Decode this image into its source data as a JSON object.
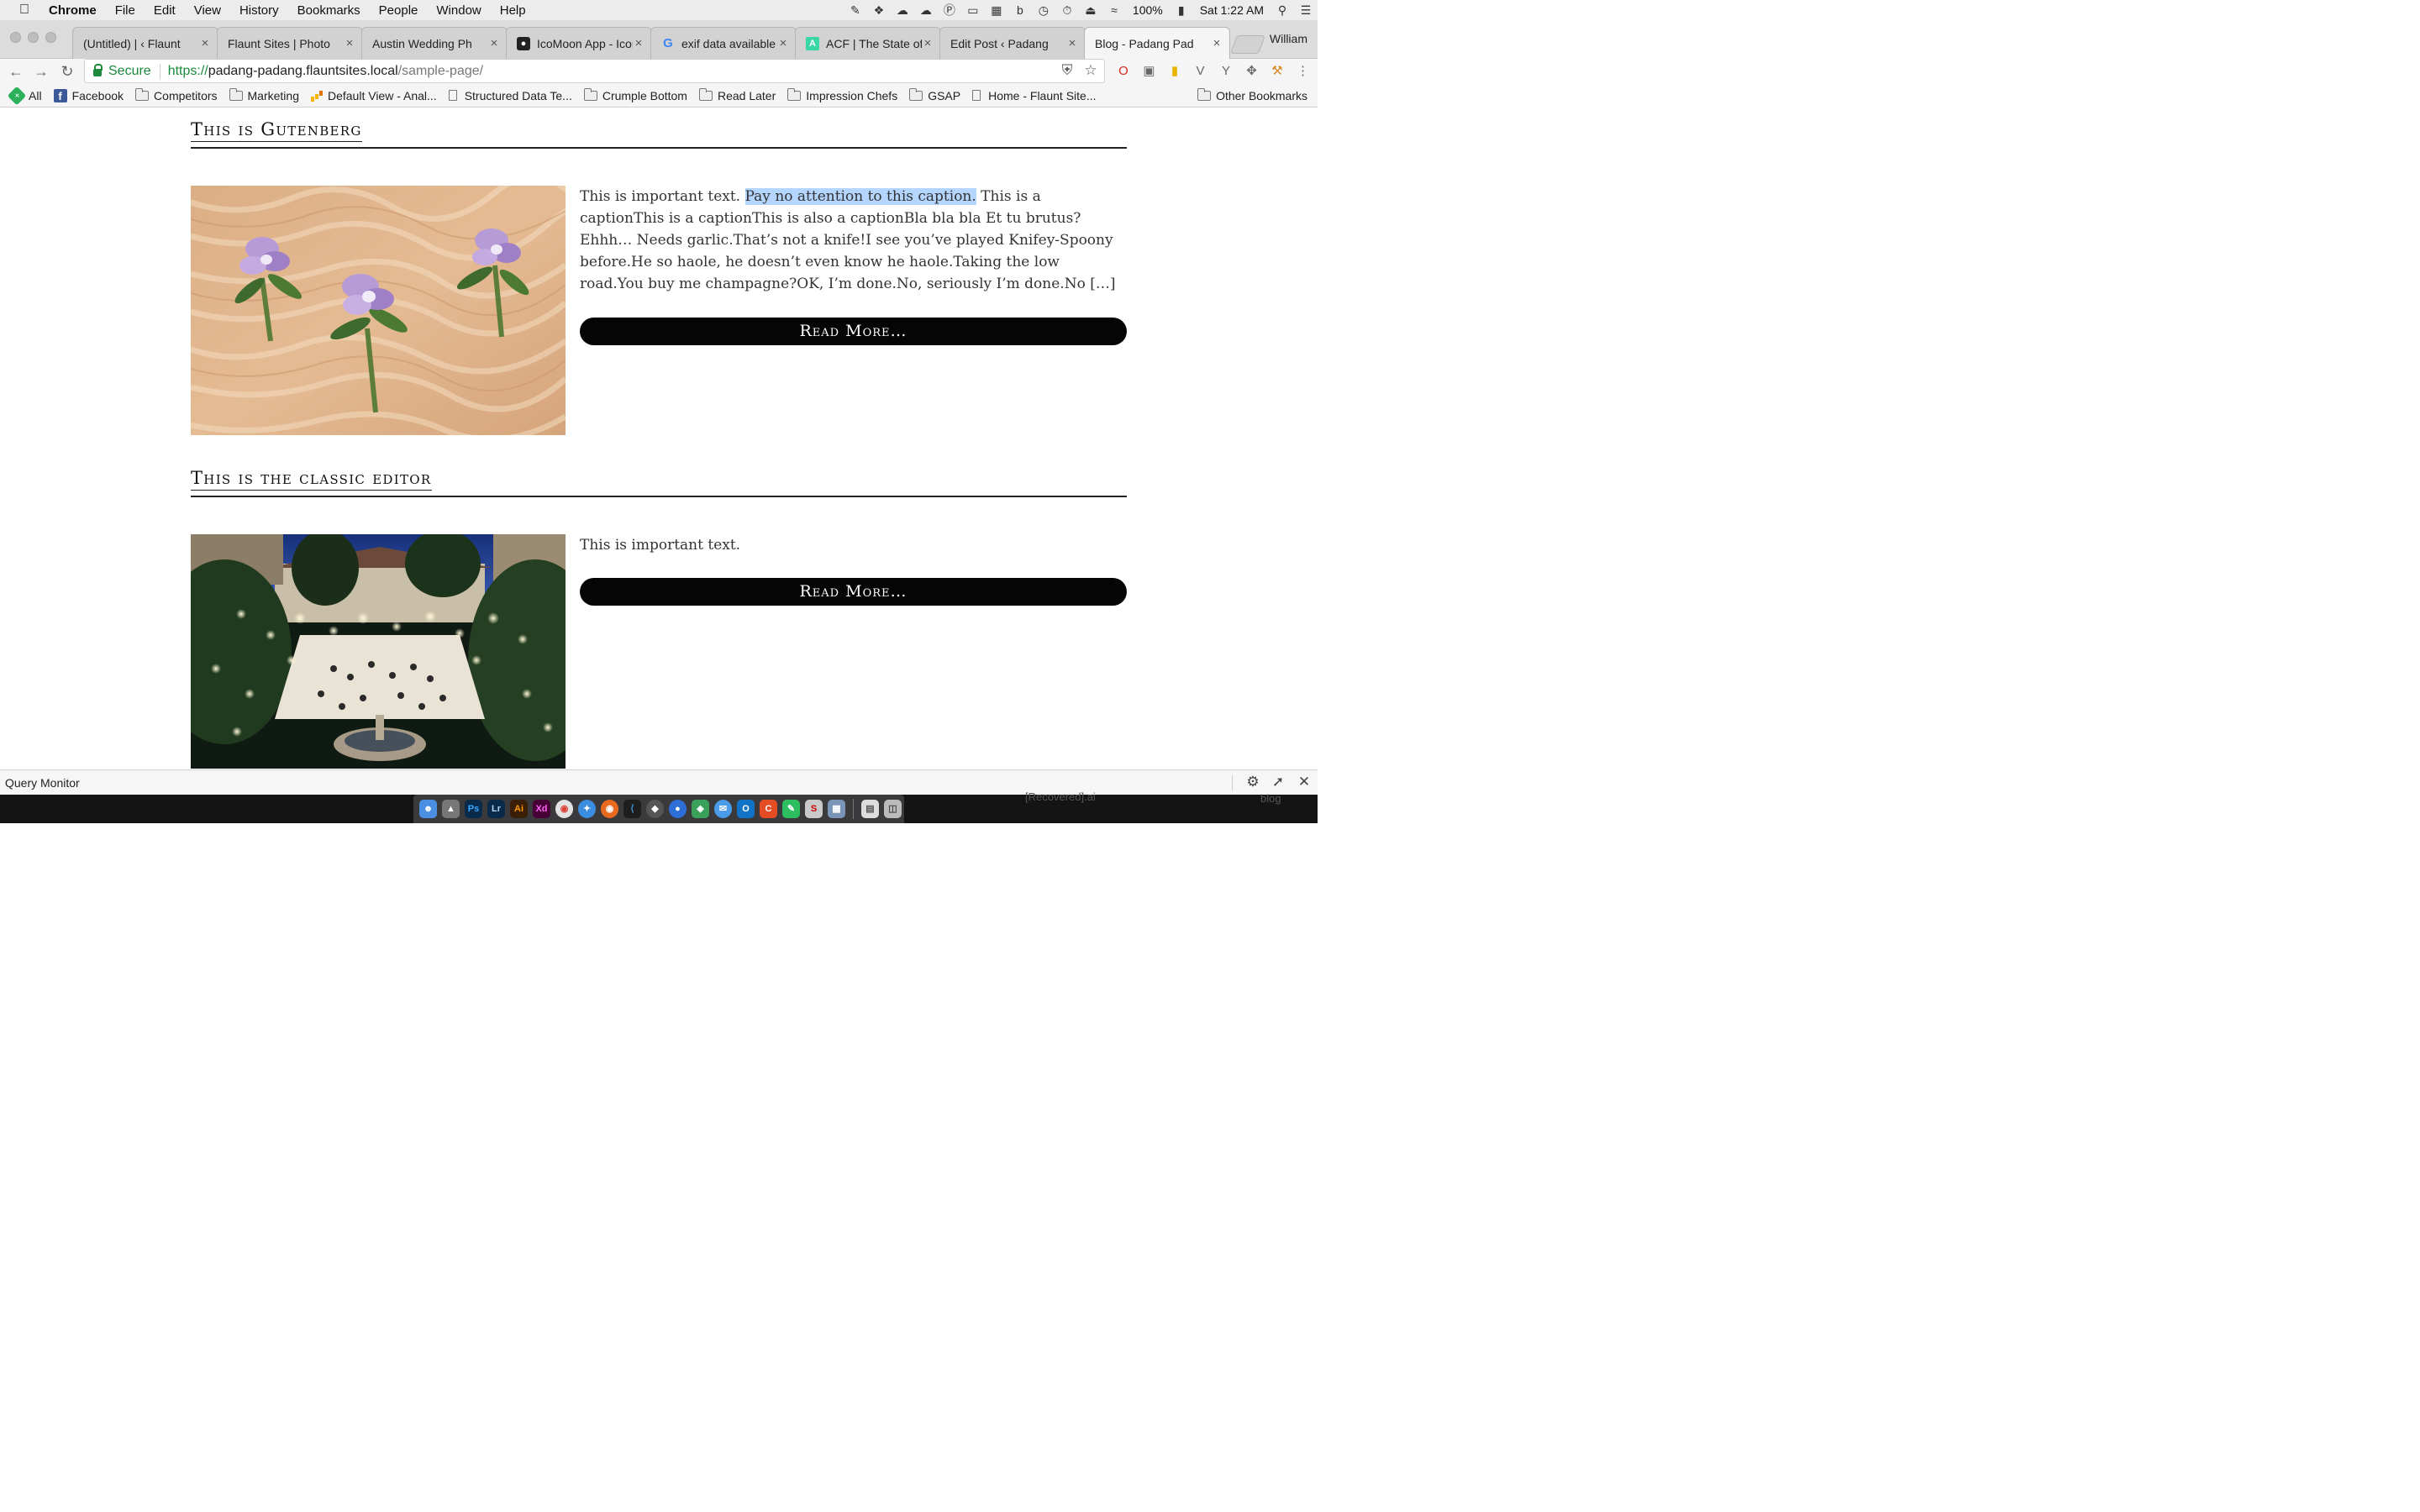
{
  "menubar": {
    "app_name": "Chrome",
    "items": [
      "File",
      "Edit",
      "View",
      "History",
      "Bookmarks",
      "People",
      "Window",
      "Help"
    ],
    "battery": "100%",
    "clock": "Sat 1:22 AM"
  },
  "tabs": [
    {
      "title": "(Untitled) | ‹ Flaunt",
      "icon": "page-icon"
    },
    {
      "title": "Flaunt Sites | Photo",
      "icon": "page-icon"
    },
    {
      "title": "Austin Wedding Ph",
      "icon": "page-icon"
    },
    {
      "title": "IcoMoon App - Icon",
      "icon": "icomoon-icon"
    },
    {
      "title": "exif data available",
      "icon": "google-icon"
    },
    {
      "title": "ACF | The State of",
      "icon": "acf-icon"
    },
    {
      "title": "Edit Post ‹ Padang",
      "icon": "page-icon"
    },
    {
      "title": "Blog - Padang Pad",
      "icon": "page-icon"
    }
  ],
  "profile_name": "William",
  "address_bar": {
    "secure_label": "Secure",
    "scheme": "https://",
    "host": "padang-padang.flauntsites.local",
    "path": "/sample-page/"
  },
  "bookmarks": [
    {
      "label": "All",
      "icon": "all-icon"
    },
    {
      "label": "Facebook",
      "icon": "facebook-icon"
    },
    {
      "label": "Competitors",
      "icon": "folder-icon"
    },
    {
      "label": "Marketing",
      "icon": "folder-icon"
    },
    {
      "label": "Default View - Anal...",
      "icon": "analytics-icon"
    },
    {
      "label": "Structured Data Te...",
      "icon": "page-icon"
    },
    {
      "label": "Crumple Bottom",
      "icon": "folder-icon"
    },
    {
      "label": "Read Later",
      "icon": "folder-icon"
    },
    {
      "label": "Impression Chefs",
      "icon": "folder-icon"
    },
    {
      "label": "GSAP",
      "icon": "folder-icon"
    },
    {
      "label": "Home - Flaunt Site...",
      "icon": "page-icon"
    }
  ],
  "other_bookmarks": "Other Bookmarks",
  "posts": [
    {
      "title": "This is Gutenberg",
      "excerpt_before": "This is important text. ",
      "excerpt_highlight": "Pay no attention to this caption.",
      "excerpt_after": " This is a captionThis is a captionThis is also a captionBla bla bla Et tu brutus?Ehhh… Needs garlic.That’s not a knife!I see you’ve played Knifey-Spoony before.He so haole, he doesn’t even know he haole.Taking the low road.You buy me champagne?OK, I’m done.No, seriously I’m done.No […]",
      "read_more": "Read More…",
      "image": "flower-boutonnieres-photo"
    },
    {
      "title": "This is the classic editor",
      "excerpt": "This is important text.",
      "read_more": "Read More…",
      "image": "courtyard-wedding-reception-photo"
    }
  ],
  "query_monitor": {
    "title": "Query Monitor"
  },
  "dock_background": {
    "file_label": "[Recovered].ai",
    "folder_label": "blog"
  },
  "colors": {
    "highlight": "#b4d5fe",
    "button": "#050505",
    "secure_green": "#1b8a3d"
  }
}
